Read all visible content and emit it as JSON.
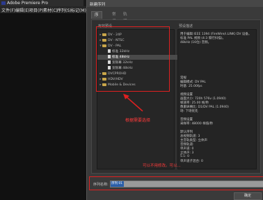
{
  "app": {
    "title": "Adobe Premiere Pro",
    "menu": [
      "文件(F)",
      "编辑(E)",
      "项目(P)",
      "素材(C)",
      "序列(S)",
      "标记(M)"
    ]
  },
  "dialog": {
    "title": "新建序列",
    "tabs": [
      "序列预设",
      "常规",
      "轨道"
    ],
    "available_presets_label": "有效预设",
    "tree": [
      {
        "label": "DV - 24P",
        "level": 0,
        "type": "folder",
        "expanded": false,
        "selected": false
      },
      {
        "label": "DV - NTSC",
        "level": 0,
        "type": "folder",
        "expanded": false,
        "selected": false
      },
      {
        "label": "DV - PAL",
        "level": 0,
        "type": "folder",
        "expanded": true,
        "selected": false
      },
      {
        "label": "标准 32kHz",
        "level": 1,
        "type": "file",
        "selected": false
      },
      {
        "label": "标准 48kHz",
        "level": 1,
        "type": "file",
        "selected": true
      },
      {
        "label": "宽银幕 32kHz",
        "level": 1,
        "type": "file",
        "selected": false
      },
      {
        "label": "宽银幕 48kHz",
        "level": 1,
        "type": "file",
        "selected": false
      },
      {
        "label": "DVCPROHD",
        "level": 0,
        "type": "folder",
        "expanded": false,
        "selected": false
      },
      {
        "label": "HDV/HDV",
        "level": 0,
        "type": "folder",
        "expanded": false,
        "selected": false
      },
      {
        "label": "Mobile & Devices",
        "level": 0,
        "type": "folder",
        "expanded": false,
        "selected": false
      }
    ],
    "desc_label": "预设描述",
    "description_lines": [
      "用于编辑 IEEE 1394 (FireWire/i.LINK) DV 设备。",
      "标准 PAL 视频 (4:3 隔行扫描)。",
      "48kHz (16位) 音频。"
    ],
    "general_lines": [
      "常规",
      "编辑模式: DV PAL",
      "时基: 25.00fps",
      "",
      "视频设置",
      "画面大小: 720h 576v (1.0940)",
      "帧速率: 25.00 帧/秒",
      "像素纵横比: D1/DV PAL (1.0940)",
      "场: 下场优先",
      "",
      "音频设置",
      "采样率: 48000 样值/秒",
      "",
      "默认序列",
      "总视频轨道: 3",
      "主音轨类型: 立体声",
      "音频轨道:",
      "单声道: 0",
      "立体声: 3",
      "5.1: 0",
      "单声道子混合: 0"
    ],
    "annotation_select": "根据需要选择",
    "annotation_name": "可以不用修改。可以...",
    "sequence_name_label": "序列名称:",
    "sequence_name_value": "序列 01",
    "ok_button": "确定",
    "accent_red": "#e02020"
  }
}
